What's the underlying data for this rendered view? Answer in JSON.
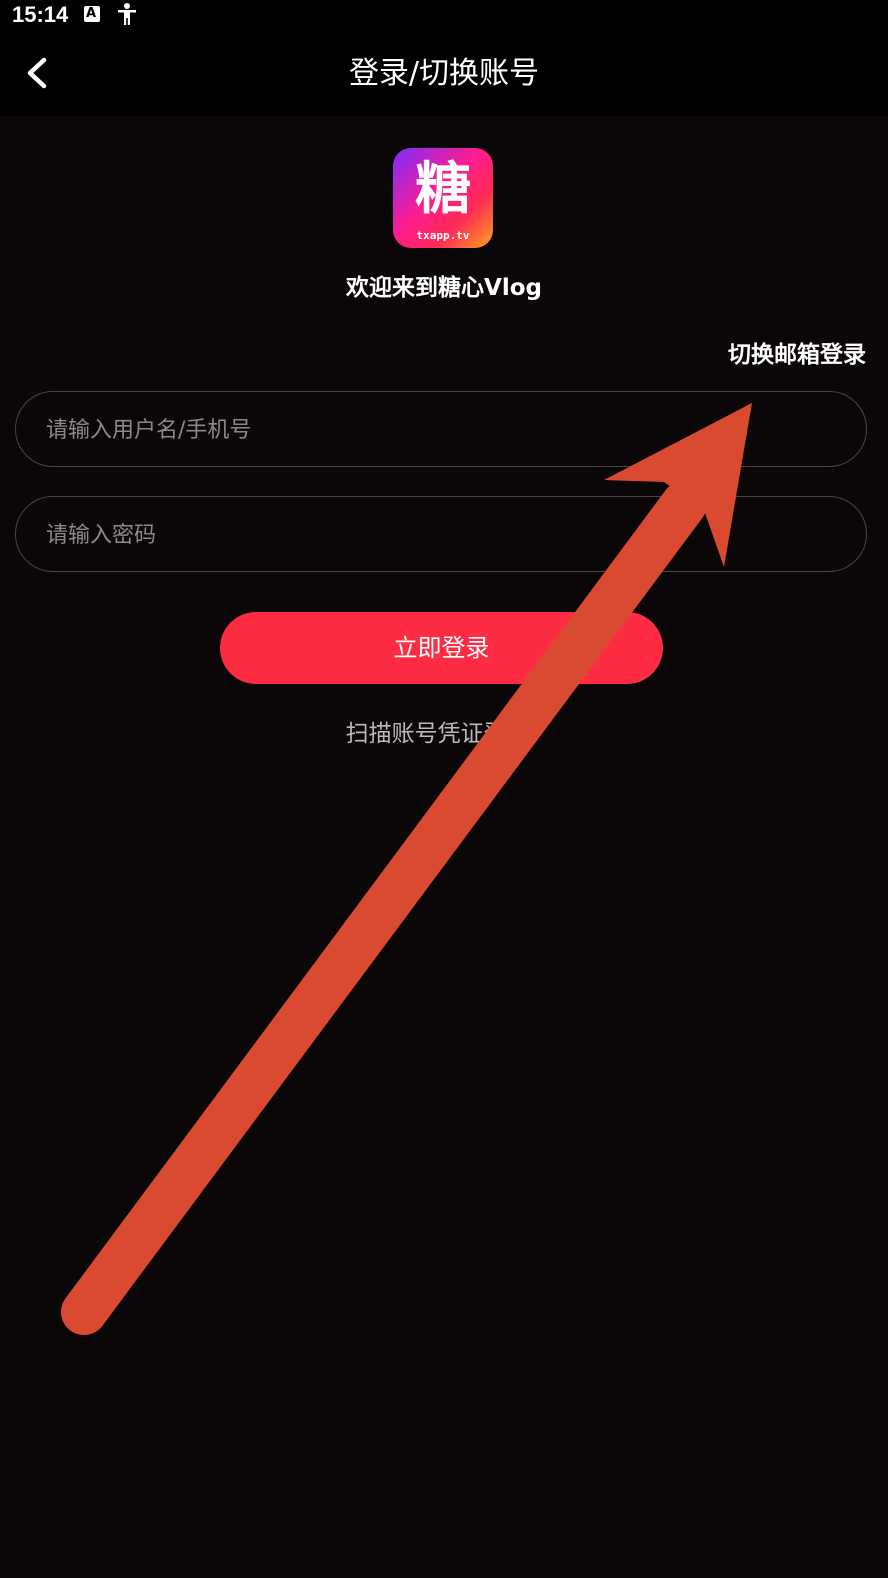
{
  "status_bar": {
    "time": "15:14",
    "icons": [
      "a-notification-icon",
      "accessibility-icon"
    ]
  },
  "header": {
    "title": "登录/切换账号",
    "back_icon": "chevron-left-icon"
  },
  "logo": {
    "glyph": "糖",
    "domain": "txapp.tv"
  },
  "welcome": "欢迎来到糖心Vlog",
  "switch_email_label": "切换邮箱登录",
  "form": {
    "username_placeholder": "请输入用户名/手机号",
    "username_value": "",
    "password_placeholder": "请输入密码",
    "password_value": ""
  },
  "login_button_label": "立即登录",
  "scan_link_label": "扫描账号凭证登录",
  "colors": {
    "background": "#0b0709",
    "accent": "#fe2c43",
    "annotation_arrow": "#d94a30"
  }
}
